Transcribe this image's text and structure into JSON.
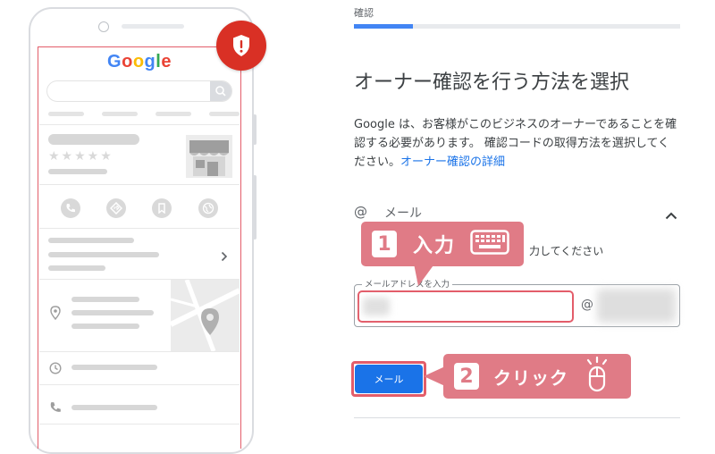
{
  "phone_mock": {
    "logo": "Google",
    "logo_colors": [
      "#4285F4",
      "#EA4335",
      "#FBBC05",
      "#4285F4",
      "#34A853",
      "#EA4335"
    ],
    "rating_stars": "★★★★★"
  },
  "step": {
    "label": "確認",
    "progress_fraction": 0.18
  },
  "page": {
    "title": "オーナー確認を行う方法を選択",
    "description": "Google は、お客様がこのビジネスのオーナーであることを確認する必要があります。 確認コードの取得方法を選択してください。",
    "details_link": "オーナー確認の詳細"
  },
  "method": {
    "icon": "@",
    "label": "メール",
    "help_text_visible": "力してください"
  },
  "email_field": {
    "label": "メールアドレスを入力",
    "value": "",
    "at_sign": "@"
  },
  "submit": {
    "label": "メール"
  },
  "callouts": [
    {
      "number": "1",
      "text": "入力",
      "icon": "keyboard-icon"
    },
    {
      "number": "2",
      "text": "クリック",
      "icon": "mouse-click-icon"
    }
  ],
  "colors": {
    "accent": "#1a73e8",
    "callout": "#e07b86",
    "highlight": "#e35d6a",
    "alert": "#d93025"
  }
}
